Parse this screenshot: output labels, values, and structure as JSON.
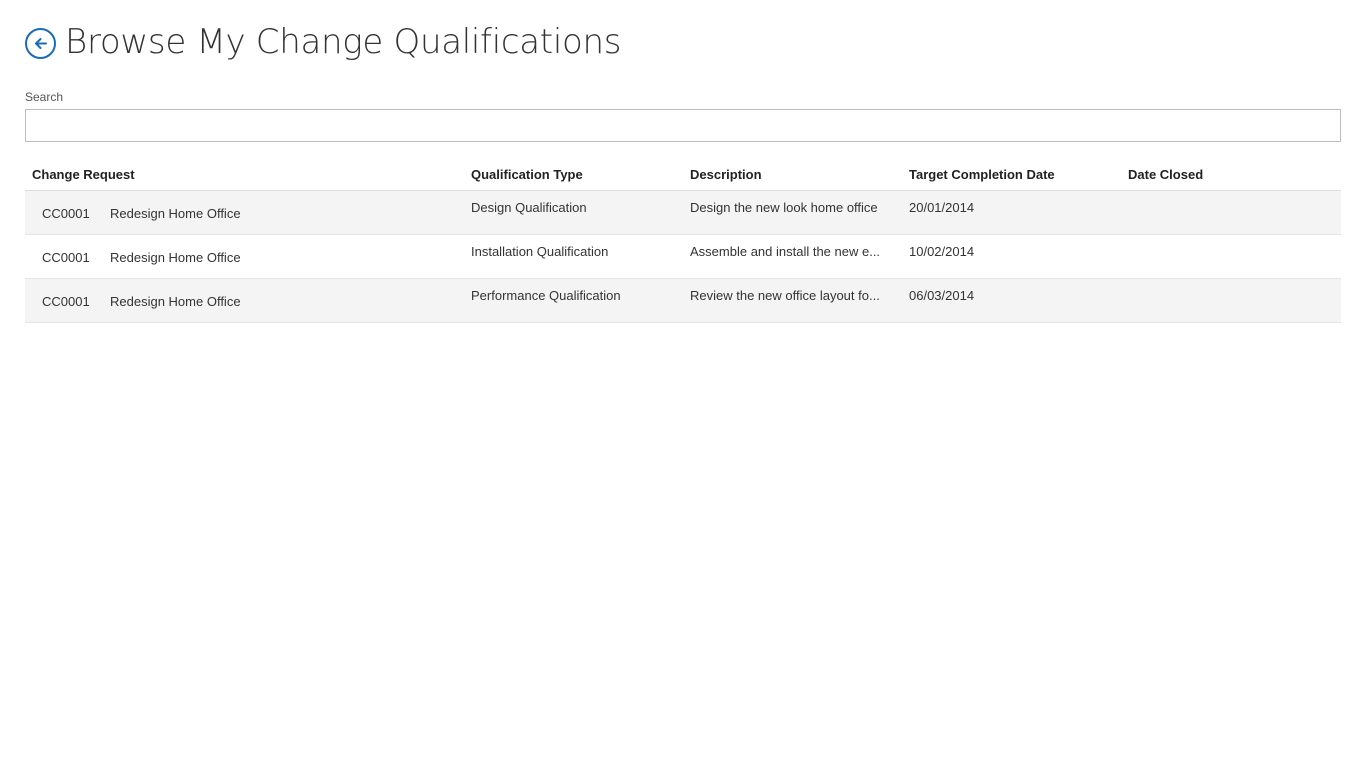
{
  "header": {
    "title": "Browse My Change Qualifications",
    "back_icon": "back-arrow-icon",
    "accent_color": "#1a6bb8"
  },
  "search": {
    "label": "Search",
    "value": "",
    "placeholder": ""
  },
  "table": {
    "columns": [
      "Change Request",
      "Qualification Type",
      "Description",
      "Target Completion Date",
      "Date Closed"
    ],
    "rows": [
      {
        "change_request_id": "CC0001",
        "change_request_name": "Redesign Home Office",
        "qualification_type": "Design Qualification",
        "description": "Design the new look home office",
        "target_completion_date": "20/01/2014",
        "date_closed": ""
      },
      {
        "change_request_id": "CC0001",
        "change_request_name": "Redesign Home Office",
        "qualification_type": "Installation Qualification",
        "description": "Assemble and install the new e...",
        "target_completion_date": "10/02/2014",
        "date_closed": ""
      },
      {
        "change_request_id": "CC0001",
        "change_request_name": "Redesign Home Office",
        "qualification_type": "Performance Qualification",
        "description": "Review the new office layout fo...",
        "target_completion_date": "06/03/2014",
        "date_closed": ""
      }
    ]
  }
}
